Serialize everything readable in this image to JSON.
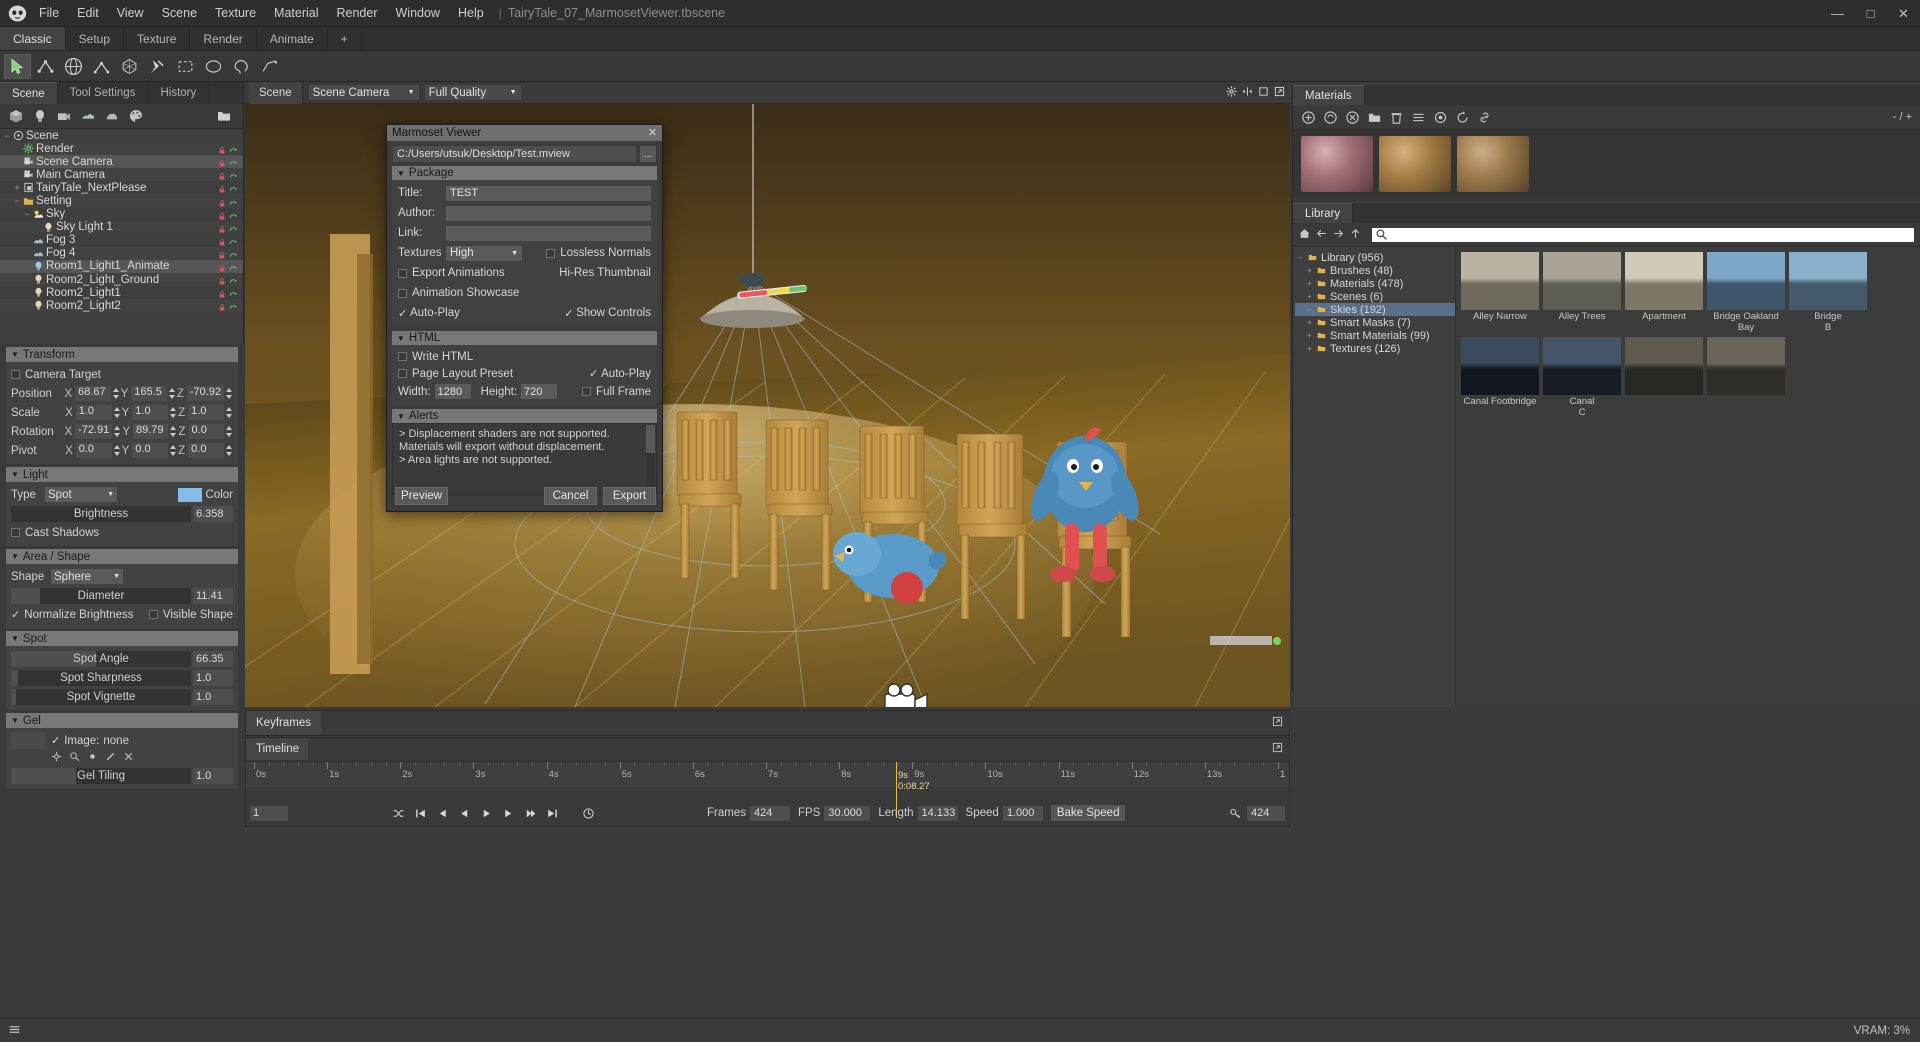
{
  "titlebar": {
    "menus": [
      "File",
      "Edit",
      "View",
      "Scene",
      "Texture",
      "Material",
      "Render",
      "Window",
      "Help"
    ],
    "separator": "|",
    "document": "TairyTale_07_MarmosetViewer.tbscene",
    "minimize": "—",
    "maximize": "□",
    "close": "✕"
  },
  "layout_tabs": [
    {
      "label": "Classic",
      "active": true
    },
    {
      "label": "Setup",
      "active": false
    },
    {
      "label": "Texture",
      "active": false
    },
    {
      "label": "Render",
      "active": false
    },
    {
      "label": "Animate",
      "active": false
    },
    {
      "label": "+",
      "active": false
    }
  ],
  "toolbar": {
    "tools": [
      "select-tool",
      "translate-tool",
      "rotate-tool",
      "scale-tool",
      "transform-tool",
      "pin-tool",
      "marquee-select-tool",
      "ellipse-select-tool",
      "lasso-select-tool",
      "polygon-select-tool"
    ]
  },
  "left_panel": {
    "tabs": [
      {
        "label": "Scene",
        "active": true
      },
      {
        "label": "Tool Settings",
        "active": false
      },
      {
        "label": "History",
        "active": false
      }
    ],
    "scene_toolbar": [
      "add-mesh-icon",
      "add-light-icon",
      "add-camera-icon",
      "add-fog-icon",
      "add-sky-icon",
      "add-material-icon",
      "add-folder-icon"
    ],
    "tree": [
      {
        "label": "Scene",
        "indent": 0,
        "icon": "scene-icon",
        "twist": "−",
        "selected": false
      },
      {
        "label": "Render",
        "indent": 1,
        "icon": "render-gear-icon",
        "twist": "",
        "selected": false
      },
      {
        "label": "Scene Camera",
        "indent": 1,
        "icon": "camera-icon",
        "twist": "",
        "selected": false,
        "highlight": true
      },
      {
        "label": "Main Camera",
        "indent": 1,
        "icon": "camera-icon",
        "twist": "",
        "selected": false
      },
      {
        "label": "TairyTale_NextPlease",
        "indent": 1,
        "icon": "mesh-icon",
        "twist": "+",
        "selected": false
      },
      {
        "label": "Setting",
        "indent": 1,
        "icon": "folder-icon",
        "twist": "−",
        "selected": false
      },
      {
        "label": "Sky",
        "indent": 2,
        "icon": "sky-icon",
        "twist": "−",
        "selected": false
      },
      {
        "label": "Sky Light 1",
        "indent": 3,
        "icon": "light-icon",
        "twist": "",
        "selected": false
      },
      {
        "label": "Fog 3",
        "indent": 2,
        "icon": "fog-icon",
        "twist": "",
        "selected": false
      },
      {
        "label": "Fog 4",
        "indent": 2,
        "icon": "fog-icon",
        "twist": "",
        "selected": false
      },
      {
        "label": "Room1_Light1_Animate",
        "indent": 2,
        "icon": "light-blue-icon",
        "twist": "",
        "selected": true
      },
      {
        "label": "Room2_Light_Ground",
        "indent": 2,
        "icon": "light-icon",
        "twist": "",
        "selected": false
      },
      {
        "label": "Room2_Light1",
        "indent": 2,
        "icon": "light-icon",
        "twist": "",
        "selected": false
      },
      {
        "label": "Room2_Light2",
        "indent": 2,
        "icon": "light-icon",
        "twist": "",
        "selected": false
      }
    ],
    "transform": {
      "title": "Transform",
      "camera_target_label": "Camera Target",
      "camera_target_checked": false,
      "rows": [
        {
          "label": "Position",
          "x": "68.67",
          "y": "165.5",
          "z": "-70.92"
        },
        {
          "label": "Scale",
          "x": "1.0",
          "y": "1.0",
          "z": "1.0"
        },
        {
          "label": "Rotation",
          "x": "-72.91",
          "y": "89.79",
          "z": "0.0"
        },
        {
          "label": "Pivot",
          "x": "0.0",
          "y": "0.0",
          "z": "0.0"
        }
      ],
      "axis_x": "X",
      "axis_y": "Y",
      "axis_z": "Z"
    },
    "light": {
      "title": "Light",
      "type_label": "Type",
      "type_value": "Spot",
      "color_label": "Color",
      "color_hex": "#86bcea",
      "brightness_label": "Brightness",
      "brightness_value": "6.358",
      "brightness_pct": 0,
      "cast_shadows_label": "Cast Shadows",
      "cast_shadows_checked": false
    },
    "area_shape": {
      "title": "Area / Shape",
      "shape_label": "Shape",
      "shape_value": "Sphere",
      "diameter_label": "Diameter",
      "diameter_value": "11.41",
      "diameter_pct": 16,
      "normalize_label": "Normalize Brightness",
      "normalize_checked": true,
      "visible_shape_label": "Visible Shape",
      "visible_shape_checked": false
    },
    "spot": {
      "title": "Spot",
      "rows": [
        {
          "label": "Spot Angle",
          "value": "66.35",
          "pct": 47
        },
        {
          "label": "Spot Sharpness",
          "value": "1.0",
          "pct": 4
        },
        {
          "label": "Spot Vignette",
          "value": "1.0",
          "pct": 3
        }
      ]
    },
    "gel": {
      "title": "Gel",
      "image_label": "Image:",
      "image_value": "none",
      "image_checked": true,
      "tiling_label": "Gel Tiling",
      "tiling_value": "1.0",
      "tiling_pct": 36,
      "tool_icons": [
        "gel-settings-icon",
        "gel-search-icon",
        "gel-target-icon",
        "gel-edit-icon",
        "gel-clear-icon"
      ]
    }
  },
  "viewport": {
    "tab_label": "Scene",
    "camera_dropdown": "Scene Camera",
    "quality_dropdown": "Full Quality",
    "icons": [
      "viewport-settings-icon",
      "viewport-split-icon",
      "viewport-maximize-icon",
      "viewport-popout-icon"
    ]
  },
  "keyframes": {
    "tab_label": "Keyframes",
    "expand_icon": "panel-expand-icon"
  },
  "timeline": {
    "tab_label": "Timeline",
    "expand_icon": "panel-expand-icon",
    "ticks": [
      "0s",
      "1s",
      "2s",
      "3s",
      "4s",
      "5s",
      "6s",
      "7s",
      "8s",
      "9s",
      "10s",
      "11s",
      "12s",
      "13s",
      "1"
    ],
    "playhead_label": "9s",
    "playhead_time": "0:08.27",
    "frame_field": "1",
    "transport_icons": [
      "shuffle-icon",
      "skip-start-icon",
      "step-back-icon",
      "play-reverse-icon",
      "play-icon",
      "step-forward-icon",
      "play-forward-icon",
      "skip-end-icon",
      "loop-icon"
    ],
    "frames_label": "Frames",
    "frames_value": "424",
    "fps_label": "FPS",
    "fps_value": "30.000",
    "length_label": "Length",
    "length_value": "14.133",
    "speed_label": "Speed",
    "speed_value": "1.000",
    "bake_label": "Bake Speed",
    "key_icon": "key-icon",
    "key_value": "424"
  },
  "materials_panel": {
    "tab_label": "Materials",
    "count_label": "- / +",
    "toolbar_icons": [
      "add-material-icon",
      "duplicate-material-icon",
      "clear-material-icon",
      "folder-material-icon",
      "delete-material-icon",
      "list-material-icon",
      "preview-material-icon",
      "refresh-material-icon",
      "link-material-icon"
    ]
  },
  "library_panel": {
    "tab_label": "Library",
    "nav_icons": [
      "home-icon",
      "back-icon",
      "forward-icon",
      "up-icon"
    ],
    "search_icon": "search-icon",
    "tree": [
      {
        "label": "Library (956)",
        "indent": 0,
        "twist": "−",
        "selected": false
      },
      {
        "label": "Brushes (48)",
        "indent": 1,
        "twist": "+",
        "selected": false
      },
      {
        "label": "Materials (478)",
        "indent": 1,
        "twist": "+",
        "selected": false
      },
      {
        "label": "Scenes (6)",
        "indent": 1,
        "twist": "+",
        "selected": false
      },
      {
        "label": "Skies (192)",
        "indent": 1,
        "twist": "−",
        "selected": true
      },
      {
        "label": "Smart Masks (7)",
        "indent": 1,
        "twist": "+",
        "selected": false
      },
      {
        "label": "Smart Materials (99)",
        "indent": 1,
        "twist": "+",
        "selected": false
      },
      {
        "label": "Textures (126)",
        "indent": 1,
        "twist": "+",
        "selected": false
      }
    ],
    "items": [
      {
        "label": "Alley Narrow",
        "c1": "#b9b3a4",
        "c2": "#6f6a5e",
        "partial": true
      },
      {
        "label": "Alley Trees",
        "c1": "#a8a395",
        "c2": "#5f5c52"
      },
      {
        "label": "Apartment",
        "c1": "#cfc9b8",
        "c2": "#7d7768",
        "partial": true
      },
      {
        "label": "Bridge Oakland Bay",
        "c1": "#7fa8c8",
        "c2": "#3e566c"
      },
      {
        "label": "Bridge\\nB",
        "c1": "#8ab0cc",
        "c2": "#44596b",
        "partial": true
      },
      {
        "label": "Canal Footbridge",
        "c1": "#3b4a5c",
        "c2": "#12171f"
      },
      {
        "label": "Canal\\nC",
        "c1": "#44556a",
        "c2": "#171c24",
        "partial": true
      },
      {
        "label": "",
        "c1": "#5e5a50",
        "c2": "#2a2823"
      },
      {
        "label": "",
        "c1": "#6a655a",
        "c2": "#302e28",
        "partial": true
      }
    ]
  },
  "dialog": {
    "title": "Marmoset Viewer",
    "close_icon": "close-icon",
    "path_value": "C:/Users/utsuk/Desktop/Test.mview",
    "browse_label": "...",
    "package": {
      "title": "Package",
      "title_label": "Title:",
      "title_value": "TEST",
      "author_label": "Author:",
      "author_value": "",
      "link_label": "Link:",
      "link_value": "",
      "textures_label": "Textures",
      "textures_value": "High",
      "lossless_normals_label": "Lossless Normals",
      "lossless_normals_checked": false,
      "export_animations_label": "Export Animations",
      "export_animations_checked": false,
      "hires_thumbnail_label": "Hi-Res Thumbnail",
      "hires_thumbnail_checked": false,
      "animation_showcase_label": "Animation Showcase",
      "animation_showcase_checked": false,
      "autoplay_label": "Auto-Play",
      "autoplay_checked": true,
      "show_controls_label": "Show Controls",
      "show_controls_checked": true
    },
    "html": {
      "title": "HTML",
      "write_html_label": "Write HTML",
      "write_html_checked": false,
      "page_layout_label": "Page Layout Preset",
      "page_layout_checked": false,
      "auto_play_label": "Auto-Play",
      "auto_play_checked": true,
      "width_label": "Width:",
      "width_value": "1280",
      "height_label": "Height:",
      "height_value": "720",
      "full_frame_label": "Full Frame",
      "full_frame_checked": false
    },
    "alerts": {
      "title": "Alerts",
      "lines": [
        "> Displacement shaders are not supported.",
        "Materials will export without displacement.",
        "> Area lights are not supported."
      ]
    },
    "buttons": {
      "preview": "Preview",
      "cancel": "Cancel",
      "export": "Export"
    }
  },
  "statusbar": {
    "menu_icon": "hamburger-icon",
    "vram_label": "VRAM: 3%"
  }
}
